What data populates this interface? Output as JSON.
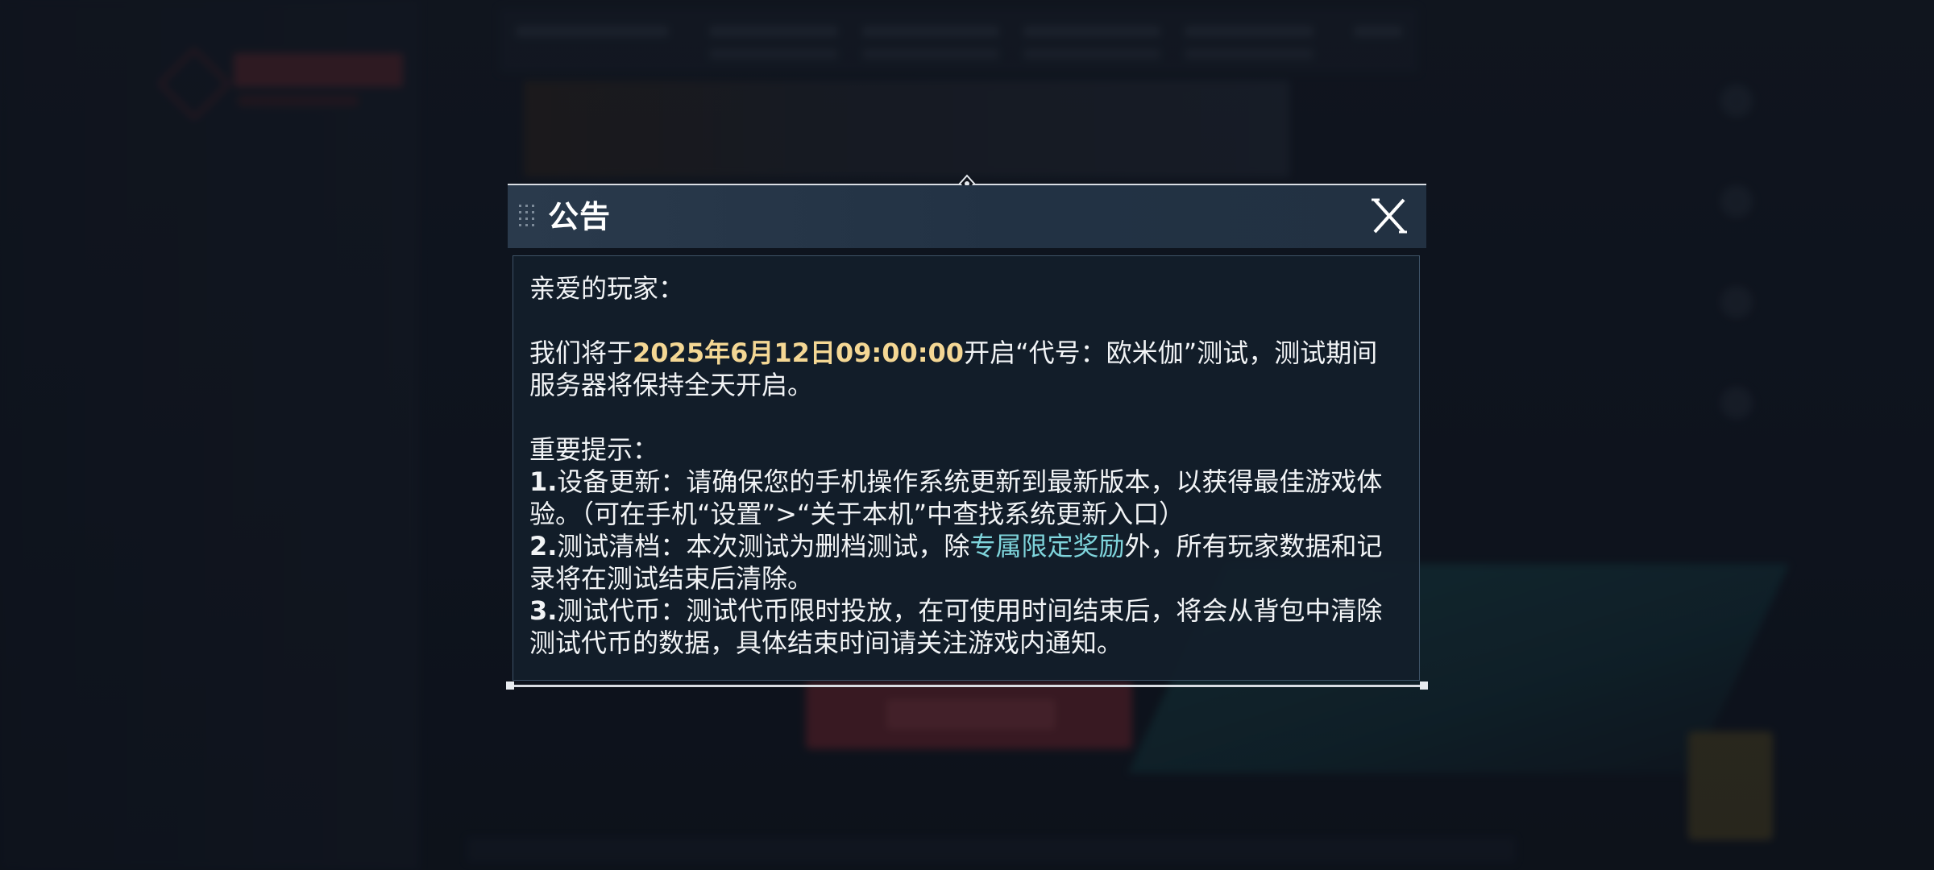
{
  "dialog": {
    "title": "公告",
    "close_icon": "close-x-icon",
    "drag_icon": "drag-handle-icon",
    "greeting": "亲爱的玩家：",
    "para1": {
      "prefix": "我们将于",
      "date": "2025年6月12日09:00:00",
      "suffix": "开启“代号：欧米伽”测试，测试期间服务器将保持全天开启。"
    },
    "notice_heading": "重要提示：",
    "item1": {
      "num": "1.",
      "text": "设备更新：请确保您的手机操作系统更新到最新版本，以获得最佳游戏体验。（可在手机“设置”>“关于本机”中查找系统更新入口）"
    },
    "item2": {
      "num": "2.",
      "prefix": "测试清档：本次测试为删档测试，除",
      "highlight": "专属限定奖励",
      "suffix": "外，所有玩家数据和记录将在测试结束后清除。"
    },
    "item3": {
      "num": "3.",
      "text": "测试代币：测试代币限时投放，在可使用时间结束后，将会从背包中清除测试代币的数据，具体结束时间请关注游戏内通知。"
    }
  },
  "colors": {
    "date_highlight": "#f4d794",
    "reward_highlight": "#7fd5dc",
    "header_bg": "#2a3a4c",
    "content_bg": "#121e2a"
  }
}
